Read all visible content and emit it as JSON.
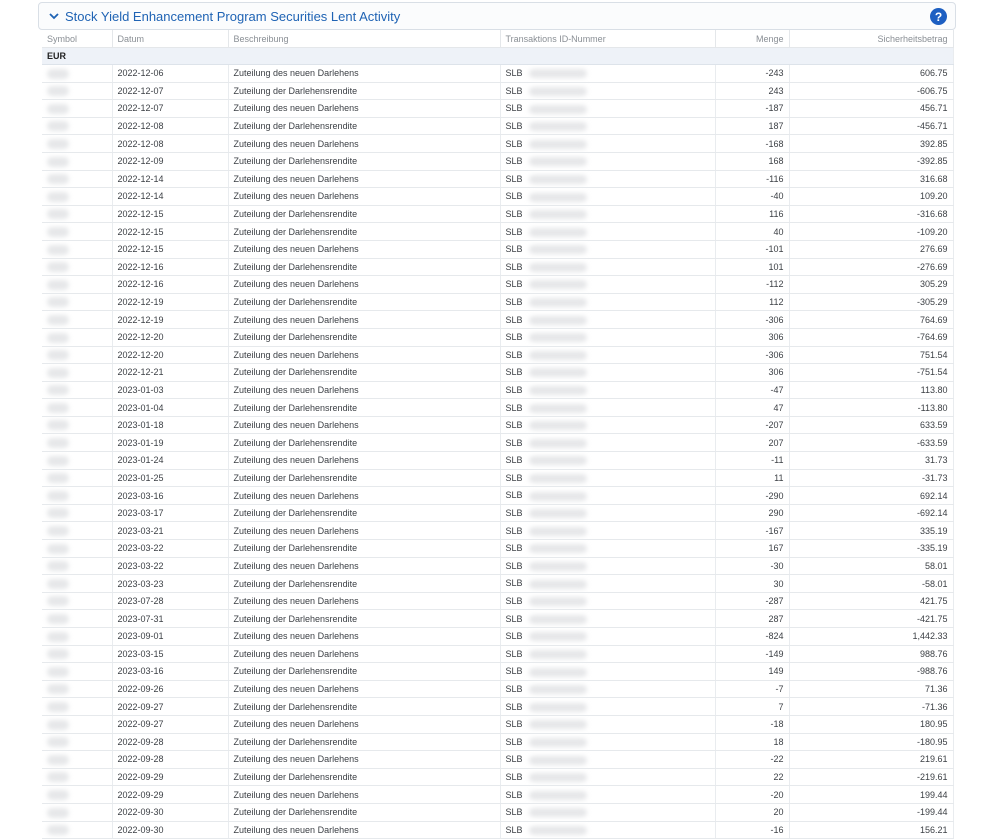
{
  "panel": {
    "title": "Stock Yield Enhancement Program Securities Lent Activity",
    "help_glyph": "?"
  },
  "columns": {
    "symbol": "Symbol",
    "date": "Datum",
    "description": "Beschreibung",
    "txid": "Transaktions ID-Nummer",
    "quantity": "Menge",
    "collateral": "Sicherheitsbetrag"
  },
  "group": {
    "currency": "EUR"
  },
  "rows": [
    {
      "date": "2022-12-06",
      "desc": "Zuteilung des neuen Darlehens",
      "txid": "SLB",
      "qty": "-243",
      "amount": "606.75"
    },
    {
      "date": "2022-12-07",
      "desc": "Zuteilung der Darlehensrendite",
      "txid": "SLB",
      "qty": "243",
      "amount": "-606.75"
    },
    {
      "date": "2022-12-07",
      "desc": "Zuteilung des neuen Darlehens",
      "txid": "SLB",
      "qty": "-187",
      "amount": "456.71"
    },
    {
      "date": "2022-12-08",
      "desc": "Zuteilung der Darlehensrendite",
      "txid": "SLB",
      "qty": "187",
      "amount": "-456.71"
    },
    {
      "date": "2022-12-08",
      "desc": "Zuteilung des neuen Darlehens",
      "txid": "SLB",
      "qty": "-168",
      "amount": "392.85"
    },
    {
      "date": "2022-12-09",
      "desc": "Zuteilung der Darlehensrendite",
      "txid": "SLB",
      "qty": "168",
      "amount": "-392.85"
    },
    {
      "date": "2022-12-14",
      "desc": "Zuteilung des neuen Darlehens",
      "txid": "SLB",
      "qty": "-116",
      "amount": "316.68"
    },
    {
      "date": "2022-12-14",
      "desc": "Zuteilung des neuen Darlehens",
      "txid": "SLB",
      "qty": "-40",
      "amount": "109.20"
    },
    {
      "date": "2022-12-15",
      "desc": "Zuteilung der Darlehensrendite",
      "txid": "SLB",
      "qty": "116",
      "amount": "-316.68"
    },
    {
      "date": "2022-12-15",
      "desc": "Zuteilung der Darlehensrendite",
      "txid": "SLB",
      "qty": "40",
      "amount": "-109.20"
    },
    {
      "date": "2022-12-15",
      "desc": "Zuteilung des neuen Darlehens",
      "txid": "SLB",
      "qty": "-101",
      "amount": "276.69"
    },
    {
      "date": "2022-12-16",
      "desc": "Zuteilung der Darlehensrendite",
      "txid": "SLB",
      "qty": "101",
      "amount": "-276.69"
    },
    {
      "date": "2022-12-16",
      "desc": "Zuteilung des neuen Darlehens",
      "txid": "SLB",
      "qty": "-112",
      "amount": "305.29"
    },
    {
      "date": "2022-12-19",
      "desc": "Zuteilung der Darlehensrendite",
      "txid": "SLB",
      "qty": "112",
      "amount": "-305.29"
    },
    {
      "date": "2022-12-19",
      "desc": "Zuteilung des neuen Darlehens",
      "txid": "SLB",
      "qty": "-306",
      "amount": "764.69"
    },
    {
      "date": "2022-12-20",
      "desc": "Zuteilung der Darlehensrendite",
      "txid": "SLB",
      "qty": "306",
      "amount": "-764.69"
    },
    {
      "date": "2022-12-20",
      "desc": "Zuteilung des neuen Darlehens",
      "txid": "SLB",
      "qty": "-306",
      "amount": "751.54"
    },
    {
      "date": "2022-12-21",
      "desc": "Zuteilung der Darlehensrendite",
      "txid": "SLB",
      "qty": "306",
      "amount": "-751.54"
    },
    {
      "date": "2023-01-03",
      "desc": "Zuteilung des neuen Darlehens",
      "txid": "SLB",
      "qty": "-47",
      "amount": "113.80"
    },
    {
      "date": "2023-01-04",
      "desc": "Zuteilung der Darlehensrendite",
      "txid": "SLB",
      "qty": "47",
      "amount": "-113.80"
    },
    {
      "date": "2023-01-18",
      "desc": "Zuteilung des neuen Darlehens",
      "txid": "SLB",
      "qty": "-207",
      "amount": "633.59"
    },
    {
      "date": "2023-01-19",
      "desc": "Zuteilung der Darlehensrendite",
      "txid": "SLB",
      "qty": "207",
      "amount": "-633.59"
    },
    {
      "date": "2023-01-24",
      "desc": "Zuteilung des neuen Darlehens",
      "txid": "SLB",
      "qty": "-11",
      "amount": "31.73"
    },
    {
      "date": "2023-01-25",
      "desc": "Zuteilung der Darlehensrendite",
      "txid": "SLB",
      "qty": "11",
      "amount": "-31.73"
    },
    {
      "date": "2023-03-16",
      "desc": "Zuteilung des neuen Darlehens",
      "txid": "SLB",
      "qty": "-290",
      "amount": "692.14"
    },
    {
      "date": "2023-03-17",
      "desc": "Zuteilung der Darlehensrendite",
      "txid": "SLB",
      "qty": "290",
      "amount": "-692.14"
    },
    {
      "date": "2023-03-21",
      "desc": "Zuteilung des neuen Darlehens",
      "txid": "SLB",
      "qty": "-167",
      "amount": "335.19"
    },
    {
      "date": "2023-03-22",
      "desc": "Zuteilung der Darlehensrendite",
      "txid": "SLB",
      "qty": "167",
      "amount": "-335.19"
    },
    {
      "date": "2023-03-22",
      "desc": "Zuteilung des neuen Darlehens",
      "txid": "SLB",
      "qty": "-30",
      "amount": "58.01"
    },
    {
      "date": "2023-03-23",
      "desc": "Zuteilung der Darlehensrendite",
      "txid": "SLB",
      "qty": "30",
      "amount": "-58.01"
    },
    {
      "date": "2023-07-28",
      "desc": "Zuteilung des neuen Darlehens",
      "txid": "SLB",
      "qty": "-287",
      "amount": "421.75"
    },
    {
      "date": "2023-07-31",
      "desc": "Zuteilung der Darlehensrendite",
      "txid": "SLB",
      "qty": "287",
      "amount": "-421.75"
    },
    {
      "date": "2023-09-01",
      "desc": "Zuteilung des neuen Darlehens",
      "txid": "SLB",
      "qty": "-824",
      "amount": "1,442.33"
    },
    {
      "date": "2023-03-15",
      "desc": "Zuteilung des neuen Darlehens",
      "txid": "SLB",
      "qty": "-149",
      "amount": "988.76"
    },
    {
      "date": "2023-03-16",
      "desc": "Zuteilung der Darlehensrendite",
      "txid": "SLB",
      "qty": "149",
      "amount": "-988.76"
    },
    {
      "date": "2022-09-26",
      "desc": "Zuteilung des neuen Darlehens",
      "txid": "SLB",
      "qty": "-7",
      "amount": "71.36"
    },
    {
      "date": "2022-09-27",
      "desc": "Zuteilung der Darlehensrendite",
      "txid": "SLB",
      "qty": "7",
      "amount": "-71.36"
    },
    {
      "date": "2022-09-27",
      "desc": "Zuteilung des neuen Darlehens",
      "txid": "SLB",
      "qty": "-18",
      "amount": "180.95"
    },
    {
      "date": "2022-09-28",
      "desc": "Zuteilung der Darlehensrendite",
      "txid": "SLB",
      "qty": "18",
      "amount": "-180.95"
    },
    {
      "date": "2022-09-28",
      "desc": "Zuteilung des neuen Darlehens",
      "txid": "SLB",
      "qty": "-22",
      "amount": "219.61"
    },
    {
      "date": "2022-09-29",
      "desc": "Zuteilung der Darlehensrendite",
      "txid": "SLB",
      "qty": "22",
      "amount": "-219.61"
    },
    {
      "date": "2022-09-29",
      "desc": "Zuteilung des neuen Darlehens",
      "txid": "SLB",
      "qty": "-20",
      "amount": "199.44"
    },
    {
      "date": "2022-09-30",
      "desc": "Zuteilung der Darlehensrendite",
      "txid": "SLB",
      "qty": "20",
      "amount": "-199.44"
    },
    {
      "date": "2022-09-30",
      "desc": "Zuteilung des neuen Darlehens",
      "txid": "SLB",
      "qty": "-16",
      "amount": "156.21"
    }
  ]
}
